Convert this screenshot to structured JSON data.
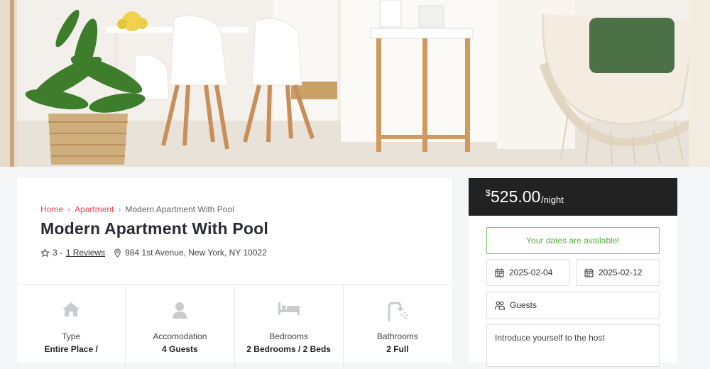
{
  "breadcrumb": {
    "home": "Home",
    "category": "Apartment",
    "current": "Modern Apartment With Pool",
    "separator": "›"
  },
  "listing": {
    "title": "Modern Apartment With Pool",
    "rating": "3",
    "rating_sep": "-",
    "reviews": "1 Reviews",
    "address": "984 1st Avenue, New York, NY 10022"
  },
  "features": [
    {
      "label": "Type",
      "value": "Entire Place /",
      "icon": "home-icon"
    },
    {
      "label": "Accomodation",
      "value": "4 Guests",
      "icon": "person-icon"
    },
    {
      "label": "Bedrooms",
      "value": "2 Bedrooms / 2 Beds",
      "icon": "bed-icon"
    },
    {
      "label": "Bathrooms",
      "value": "2 Full",
      "icon": "shower-icon"
    }
  ],
  "booking": {
    "currency": "$",
    "price": "525.00",
    "per": "/night",
    "availability": "Your dates are available!",
    "check_in": "2025-02-04",
    "check_out": "2025-02-12",
    "guests_placeholder": "Guests",
    "message_placeholder": "Introduce yourself to the host"
  },
  "colors": {
    "accent": "#e4475d",
    "price_bar": "#222222",
    "available": "#5cae43"
  }
}
